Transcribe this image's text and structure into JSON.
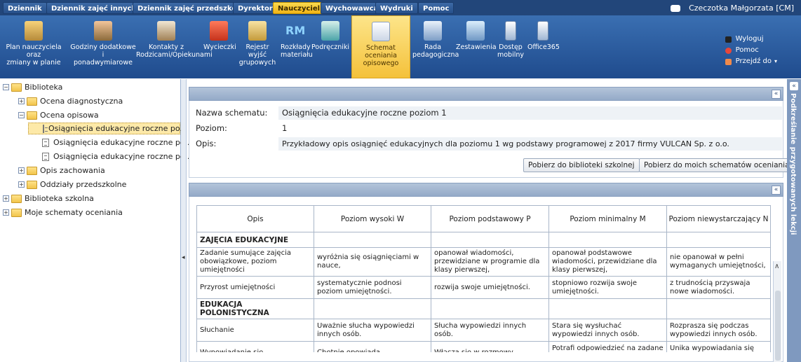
{
  "top_menu": {
    "tabs": [
      "Dziennik",
      "Dziennik zajęć innych",
      "Dziennik zajęć przedszkola",
      "Dyrektor",
      "Nauczyciel",
      "Wychowawca",
      "Wydruki",
      "Pomoc"
    ],
    "active": "Nauczyciel",
    "user": "Czeczotka Małgorzata [CM]"
  },
  "toolbar": {
    "items": [
      {
        "label": "Plan nauczyciela oraz\nzmiany w planie",
        "icon": "teacher-plan-icon"
      },
      {
        "label": "Godziny dodatkowe i\nponadwymiarowe",
        "icon": "extra-hours-icon"
      },
      {
        "label": "Kontakty z\nRodzicami/Opiekunami",
        "icon": "parent-contacts-icon"
      },
      {
        "label": "Wycieczki",
        "icon": "trips-icon"
      },
      {
        "label": "Rejestr wyjść\ngrupowych",
        "icon": "group-exits-icon"
      },
      {
        "label": "Rozkłady\nmateriału",
        "icon": "rm-curriculum-icon"
      },
      {
        "label": "Podręczniki",
        "icon": "textbooks-icon"
      },
      {
        "label": "Schemat oceniania\nopisowego",
        "icon": "descriptive-grading-icon"
      },
      {
        "label": "Rada\npedagogiczna",
        "icon": "pedagogical-council-icon"
      },
      {
        "label": "Zestawienia",
        "icon": "reports-icon"
      },
      {
        "label": "Dostęp\nmobilny",
        "icon": "mobile-access-icon"
      },
      {
        "label": "Office365",
        "icon": "office365-icon"
      }
    ],
    "active_index": 7,
    "side_links": [
      "Wyloguj",
      "Pomoc",
      "Przejdź do"
    ]
  },
  "tree": {
    "root": "Biblioteka",
    "ocena_diagnostyczna": "Ocena diagnostyczna",
    "ocena_opisowa": "Ocena opisowa",
    "schemat1": "Osiągnięcia edukacyjne roczne po...",
    "schemat2": "Osiągnięcia edukacyjne roczne po...",
    "schemat3": "Osiągnięcia edukacyjne roczne po...",
    "opis_zachowania": "Opis zachowania",
    "oddzialy": "Oddziały przedszkolne",
    "biblioteka_szkolna": "Biblioteka szkolna",
    "moje_schematy": "Moje schematy oceniania"
  },
  "details": {
    "name_label": "Nazwa schematu:",
    "name_value": "Osiągnięcia edukacyjne roczne poziom 1",
    "level_label": "Poziom:",
    "level_value": "1",
    "desc_label": "Opis:",
    "desc_value": "Przykładowy opis osiągnięć edukacyjnych dla poziomu 1 wg podstawy programowej z 2017 firmy VULCAN Sp. z o.o.",
    "btn_school": "Pobierz do biblioteki szkolnej",
    "btn_mine": "Pobierz do moich schematów oceniania"
  },
  "right_strip_text": "Podkreślanie przygotowanych lekcji",
  "table": {
    "headers": [
      "Opis",
      "Poziom wysoki W",
      "Poziom podstawowy P",
      "Poziom minimalny M",
      "Poziom niewystarczający N"
    ],
    "rows": [
      {
        "section": "ZAJĘCIA EDUKACYJNE"
      },
      {
        "cells": [
          "Zadanie sumujące zajęcia obowiązkowe, poziom umiejętności",
          "wyróżnia się osiągnięciami w nauce,",
          "opanował wiadomości, przewidziane w programie dla klasy pierwszej,",
          "opanował podstawowe wiadomości, przewidziane dla klasy pierwszej,",
          "nie opanował w pełni wymaganych umiejętności,"
        ]
      },
      {
        "cells": [
          "Przyrost umiejętności",
          "systematycznie podnosi poziom umiejętności.",
          "rozwija swoje umiejętności.",
          "stopniowo rozwija swoje umiejętności.",
          "z trudnością przyswaja nowe wiadomości."
        ]
      },
      {
        "section": "EDUKACJA POLONISTYCZNA"
      },
      {
        "cells": [
          "Słuchanie",
          "Uważnie słucha wypowiedzi innych osób.",
          "Słucha wypowiedzi innych osób.",
          "Stara się wysłuchać wypowiedzi innych osób.",
          "Rozprasza się podczas wypowiedzi innych osób."
        ]
      },
      {
        "cells": [
          "Wypowiadanie się",
          "Chętnie opowiada,",
          "Włącza się w rozmowy,",
          "Potrafi odpowiedzieć na zadane pytanie",
          "Unika wypowiadania się podczas zajęć"
        ]
      }
    ]
  },
  "colors": {
    "menu_bg": "#22467a",
    "active_tab": "#f1b417",
    "toolbar_bg": "#2a5a9c",
    "selection": "#fde9a8"
  }
}
